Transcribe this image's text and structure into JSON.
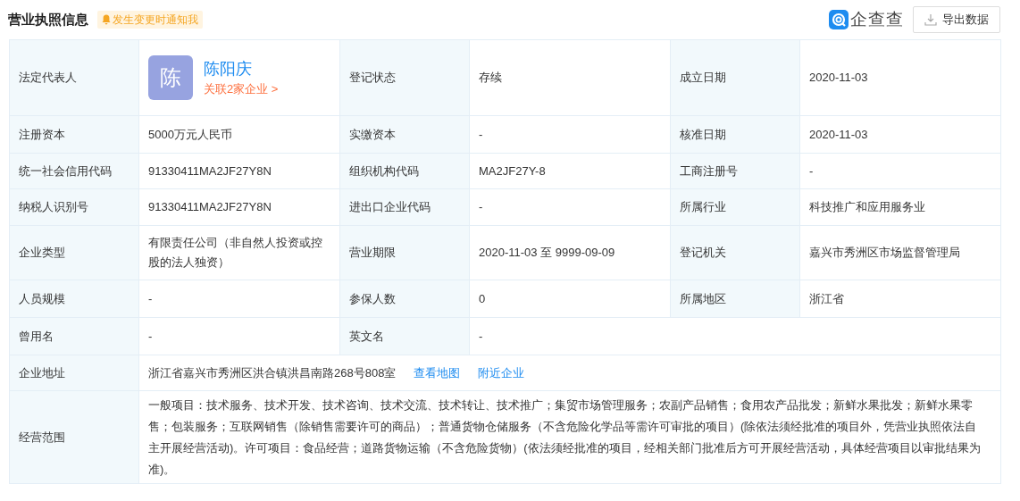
{
  "header": {
    "title": "营业执照信息",
    "notify": "发生变更时通知我",
    "logo": "企查查",
    "export": "导出数据"
  },
  "rows": [
    {
      "fields": [
        {
          "label": "法定代表人",
          "value": {
            "kind": "person",
            "avatar": "陈",
            "name": "陈阳庆",
            "related": "关联2家企业 >"
          }
        },
        {
          "label": "登记状态",
          "value": {
            "kind": "text",
            "text": "存续"
          }
        },
        {
          "label": "成立日期",
          "value": {
            "kind": "text",
            "text": "2020-11-03"
          }
        }
      ]
    },
    {
      "fields": [
        {
          "label": "注册资本",
          "value": {
            "kind": "text",
            "text": "5000万元人民币"
          }
        },
        {
          "label": "实缴资本",
          "value": {
            "kind": "text",
            "text": "-"
          }
        },
        {
          "label": "核准日期",
          "value": {
            "kind": "text",
            "text": "2020-11-03"
          }
        }
      ]
    },
    {
      "fields": [
        {
          "label": "统一社会信用代码",
          "value": {
            "kind": "text",
            "text": "91330411MA2JF27Y8N"
          }
        },
        {
          "label": "组织机构代码",
          "value": {
            "kind": "text",
            "text": "MA2JF27Y-8"
          }
        },
        {
          "label": "工商注册号",
          "value": {
            "kind": "text",
            "text": "-"
          }
        }
      ]
    },
    {
      "fields": [
        {
          "label": "纳税人识别号",
          "value": {
            "kind": "text",
            "text": "91330411MA2JF27Y8N"
          }
        },
        {
          "label": "进出口企业代码",
          "value": {
            "kind": "text",
            "text": "-"
          }
        },
        {
          "label": "所属行业",
          "value": {
            "kind": "text",
            "text": "科技推广和应用服务业"
          }
        }
      ]
    },
    {
      "fields": [
        {
          "label": "企业类型",
          "value": {
            "kind": "text",
            "text": "有限责任公司（非自然人投资或控股的法人独资）"
          }
        },
        {
          "label": "营业期限",
          "value": {
            "kind": "text",
            "text": "2020-11-03 至 9999-09-09"
          }
        },
        {
          "label": "登记机关",
          "value": {
            "kind": "text",
            "text": "嘉兴市秀洲区市场监督管理局"
          }
        }
      ]
    },
    {
      "fields": [
        {
          "label": "人员规模",
          "value": {
            "kind": "text",
            "text": "-"
          }
        },
        {
          "label": "参保人数",
          "value": {
            "kind": "text",
            "text": "0"
          }
        },
        {
          "label": "所属地区",
          "value": {
            "kind": "text",
            "text": "浙江省"
          }
        }
      ]
    },
    {
      "fields": [
        {
          "label": "曾用名",
          "value": {
            "kind": "text",
            "text": "-"
          }
        },
        {
          "label": "英文名",
          "value": {
            "kind": "text",
            "text": "-"
          }
        }
      ]
    },
    {
      "fields": [
        {
          "label": "企业地址",
          "value": {
            "kind": "address",
            "text": "浙江省嘉兴市秀洲区洪合镇洪昌南路268号808室",
            "links": [
              "查看地图",
              "附近企业"
            ]
          }
        }
      ]
    },
    {
      "fields": [
        {
          "label": "经营范围",
          "value": {
            "kind": "paragraph",
            "text": "一般项目：技术服务、技术开发、技术咨询、技术交流、技术转让、技术推广；集贸市场管理服务；农副产品销售；食用农产品批发；新鲜水果批发；新鲜水果零售；包装服务；互联网销售（除销售需要许可的商品）；普通货物仓储服务（不含危险化学品等需许可审批的项目）(除依法须经批准的项目外，凭营业执照依法自主开展经营活动)。许可项目：食品经营；道路货物运输（不含危险货物）(依法须经批准的项目，经相关部门批准后方可开展经营活动，具体经营项目以审批结果为准)。"
          }
        }
      ]
    }
  ]
}
